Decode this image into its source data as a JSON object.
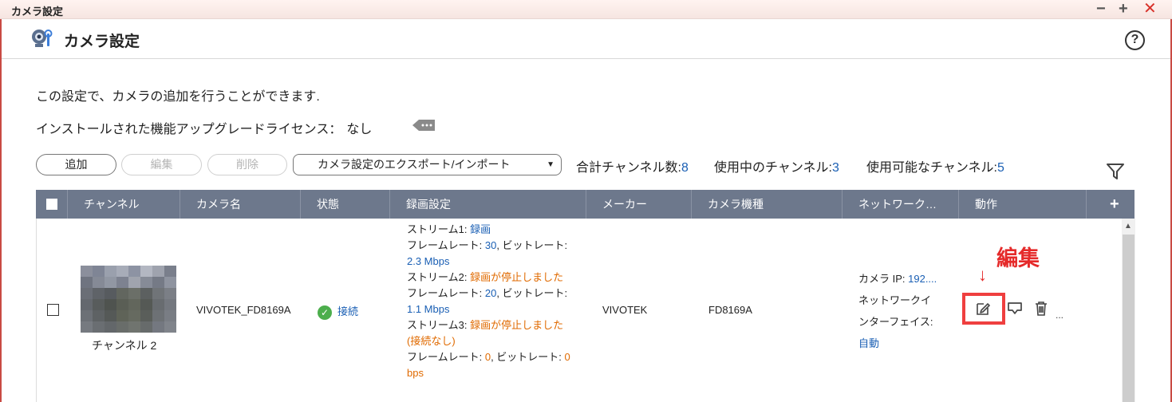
{
  "window": {
    "title": "カメラ設定",
    "min": "−",
    "max": "+",
    "close": "✕"
  },
  "header": {
    "title": "カメラ設定",
    "help": "?"
  },
  "description": "この設定で、カメラの追加を行うことができます.",
  "license": {
    "label": "インストールされた機能アップグレードライセンス：",
    "value": "なし"
  },
  "toolbar": {
    "add": "追加",
    "edit": "編集",
    "delete": "削除",
    "export_import": "カメラ設定のエクスポート/インポート"
  },
  "counts": {
    "total_label": "合計チャンネル数:",
    "total": "8",
    "used_label": "使用中のチャンネル:",
    "used": "3",
    "available_label": "使用可能なチャンネル:",
    "available": "5"
  },
  "table": {
    "columns": [
      "チャンネル",
      "カメラ名",
      "状態",
      "録画設定",
      "メーカー",
      "カメラ機種",
      "ネットワーク…",
      "動作"
    ],
    "plus": "+",
    "row": {
      "channel": "チャンネル 2",
      "camera_name": "VIVOTEK_FD8169A",
      "status": "接続",
      "rec": {
        "s1_label": "ストリーム1: ",
        "s1_value": "録画",
        "fr1_label": "フレームレート: ",
        "fr1_value": "30",
        "br1_label": ", ビットレート: ",
        "br1_value": "2.3 Mbps",
        "s2_label": "ストリーム2: ",
        "s2_value": "録画が停止しました",
        "fr2_label": "フレームレート: ",
        "fr2_value": "20",
        "br2_label": ", ビットレート: ",
        "br2_value": "1.1 Mbps",
        "s3_label": "ストリーム3: ",
        "s3_value": "録画が停止しました (接続なし)",
        "fr3_label": "フレームレート: ",
        "fr3_value": "0",
        "br3_label": ", ビットレート: ",
        "br3_value": "0 bps"
      },
      "maker": "VIVOTEK",
      "model": "FD8169A",
      "network": {
        "ip_label": "カメラ IP: ",
        "ip_value": "192....",
        "iface_label1": "ネットワークイ",
        "iface_label2": "ンターフェイス:",
        "iface_value": "自動"
      },
      "more": "..."
    }
  },
  "annotation": {
    "label": "編集",
    "arrow": "↓"
  },
  "colors": {
    "header_bg": "#6d788c",
    "accent_blue": "#1a5fb4",
    "warning_orange": "#e06a00",
    "annotation_red": "#e52a2a"
  }
}
